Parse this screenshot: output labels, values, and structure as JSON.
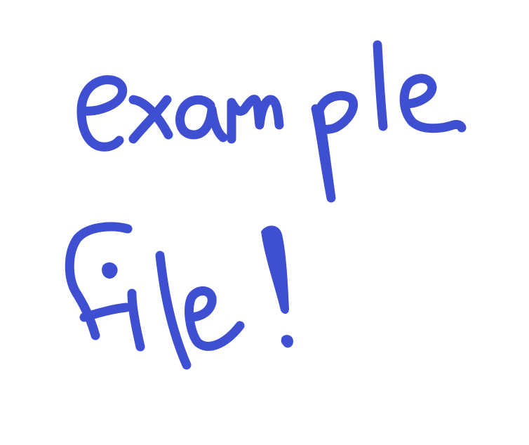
{
  "drawing": {
    "ink_color": "#3f4fd1",
    "background": "#ffffff",
    "line1": "example",
    "line2": "file!"
  }
}
